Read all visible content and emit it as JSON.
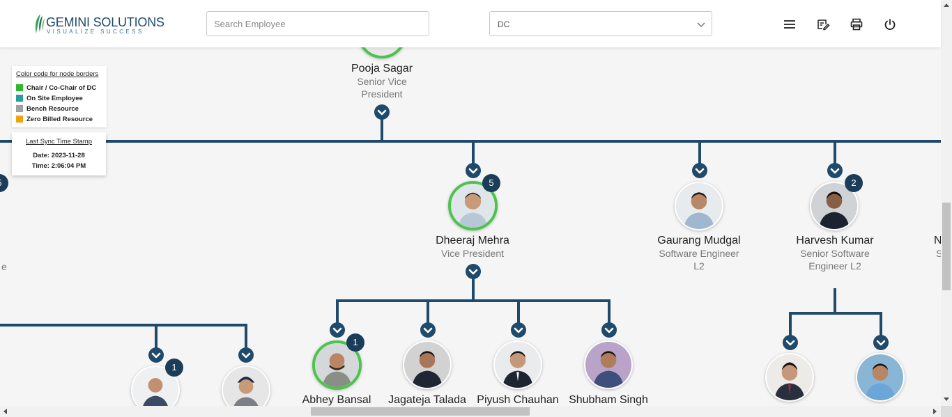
{
  "header": {
    "logo_name": "GEMINI SOLUTIONS",
    "logo_tagline": "VISUALIZE SUCCESS",
    "search_placeholder": "Search Employee",
    "search_value": "",
    "department_selected": "DC",
    "icons": [
      "menu-icon",
      "edit-note-icon",
      "print-icon",
      "power-icon"
    ]
  },
  "legend": {
    "title": "Color code for node borders",
    "items": [
      {
        "label": "Chair / Co-Chair of DC",
        "color": "#2db82d"
      },
      {
        "label": "On Site Employee",
        "color": "#2a9d9d"
      },
      {
        "label": "Bench Resource",
        "color": "#a0a0a0"
      },
      {
        "label": "Zero Billed Resource",
        "color": "#f0a30a"
      }
    ]
  },
  "sync": {
    "title": "Last Sync Time Stamp",
    "date": "Date: 2023-11-28",
    "time": "Time: 2:06:04 PM"
  },
  "colors": {
    "connector": "#1f4a6b",
    "badge": "#1c3d5a",
    "chair_border": "#4cc44c"
  },
  "tree": {
    "root": {
      "name": "Pooja Sagar",
      "role_line1": "Senior Vice",
      "role_line2": "President"
    },
    "level1": [
      {
        "name": "Dheeraj Mehra",
        "role_line1": "Vice President",
        "role_line2": "",
        "badge": "5",
        "border": "chair"
      },
      {
        "name": "Gaurang Mudgal",
        "role_line1": "Software Engineer",
        "role_line2": "L2",
        "badge": "",
        "border": "none"
      },
      {
        "name": "Harvesh Kumar",
        "role_line1": "Senior Software",
        "role_line2": "Engineer L2",
        "badge": "2",
        "border": "none"
      },
      {
        "name": "N",
        "role_line1": "S",
        "role_line2": "",
        "badge": "",
        "border": "none"
      }
    ],
    "left_partial": {
      "badge_char": "5",
      "role_char": "e"
    },
    "level2_left": [
      {
        "name": "",
        "badge": "1"
      },
      {
        "name": "",
        "badge": ""
      }
    ],
    "level2_dheeraj": [
      {
        "name": "Abhey Bansal",
        "badge": "1",
        "border": "chair"
      },
      {
        "name": "Jagateja Talada",
        "badge": "",
        "border": "none"
      },
      {
        "name": "Piyush Chauhan",
        "badge": "",
        "border": "none"
      },
      {
        "name": "Shubham Singh",
        "badge": "",
        "border": "none"
      }
    ],
    "level2_harvesh": [
      {
        "name": "",
        "badge": ""
      },
      {
        "name": "",
        "badge": ""
      }
    ]
  }
}
